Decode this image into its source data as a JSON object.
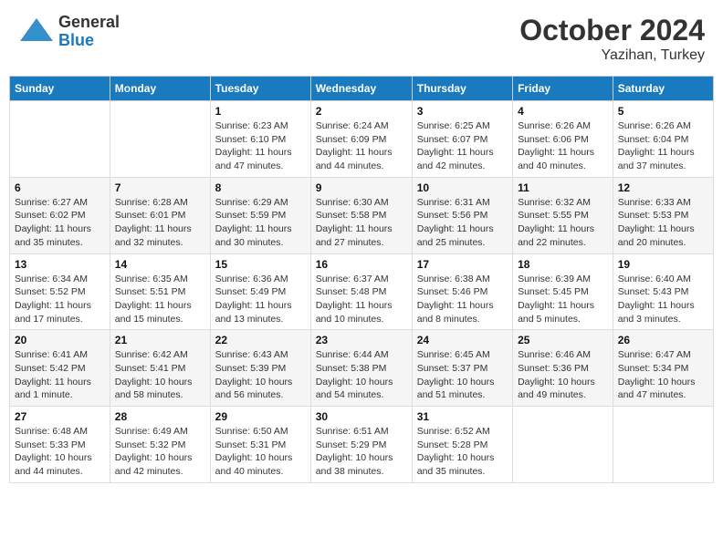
{
  "header": {
    "logo_general": "General",
    "logo_blue": "Blue",
    "month_title": "October 2024",
    "location": "Yazihan, Turkey"
  },
  "weekdays": [
    "Sunday",
    "Monday",
    "Tuesday",
    "Wednesday",
    "Thursday",
    "Friday",
    "Saturday"
  ],
  "weeks": [
    [
      {
        "day": "",
        "info": ""
      },
      {
        "day": "",
        "info": ""
      },
      {
        "day": "1",
        "info": "Sunrise: 6:23 AM\nSunset: 6:10 PM\nDaylight: 11 hours and 47 minutes."
      },
      {
        "day": "2",
        "info": "Sunrise: 6:24 AM\nSunset: 6:09 PM\nDaylight: 11 hours and 44 minutes."
      },
      {
        "day": "3",
        "info": "Sunrise: 6:25 AM\nSunset: 6:07 PM\nDaylight: 11 hours and 42 minutes."
      },
      {
        "day": "4",
        "info": "Sunrise: 6:26 AM\nSunset: 6:06 PM\nDaylight: 11 hours and 40 minutes."
      },
      {
        "day": "5",
        "info": "Sunrise: 6:26 AM\nSunset: 6:04 PM\nDaylight: 11 hours and 37 minutes."
      }
    ],
    [
      {
        "day": "6",
        "info": "Sunrise: 6:27 AM\nSunset: 6:02 PM\nDaylight: 11 hours and 35 minutes."
      },
      {
        "day": "7",
        "info": "Sunrise: 6:28 AM\nSunset: 6:01 PM\nDaylight: 11 hours and 32 minutes."
      },
      {
        "day": "8",
        "info": "Sunrise: 6:29 AM\nSunset: 5:59 PM\nDaylight: 11 hours and 30 minutes."
      },
      {
        "day": "9",
        "info": "Sunrise: 6:30 AM\nSunset: 5:58 PM\nDaylight: 11 hours and 27 minutes."
      },
      {
        "day": "10",
        "info": "Sunrise: 6:31 AM\nSunset: 5:56 PM\nDaylight: 11 hours and 25 minutes."
      },
      {
        "day": "11",
        "info": "Sunrise: 6:32 AM\nSunset: 5:55 PM\nDaylight: 11 hours and 22 minutes."
      },
      {
        "day": "12",
        "info": "Sunrise: 6:33 AM\nSunset: 5:53 PM\nDaylight: 11 hours and 20 minutes."
      }
    ],
    [
      {
        "day": "13",
        "info": "Sunrise: 6:34 AM\nSunset: 5:52 PM\nDaylight: 11 hours and 17 minutes."
      },
      {
        "day": "14",
        "info": "Sunrise: 6:35 AM\nSunset: 5:51 PM\nDaylight: 11 hours and 15 minutes."
      },
      {
        "day": "15",
        "info": "Sunrise: 6:36 AM\nSunset: 5:49 PM\nDaylight: 11 hours and 13 minutes."
      },
      {
        "day": "16",
        "info": "Sunrise: 6:37 AM\nSunset: 5:48 PM\nDaylight: 11 hours and 10 minutes."
      },
      {
        "day": "17",
        "info": "Sunrise: 6:38 AM\nSunset: 5:46 PM\nDaylight: 11 hours and 8 minutes."
      },
      {
        "day": "18",
        "info": "Sunrise: 6:39 AM\nSunset: 5:45 PM\nDaylight: 11 hours and 5 minutes."
      },
      {
        "day": "19",
        "info": "Sunrise: 6:40 AM\nSunset: 5:43 PM\nDaylight: 11 hours and 3 minutes."
      }
    ],
    [
      {
        "day": "20",
        "info": "Sunrise: 6:41 AM\nSunset: 5:42 PM\nDaylight: 11 hours and 1 minute."
      },
      {
        "day": "21",
        "info": "Sunrise: 6:42 AM\nSunset: 5:41 PM\nDaylight: 10 hours and 58 minutes."
      },
      {
        "day": "22",
        "info": "Sunrise: 6:43 AM\nSunset: 5:39 PM\nDaylight: 10 hours and 56 minutes."
      },
      {
        "day": "23",
        "info": "Sunrise: 6:44 AM\nSunset: 5:38 PM\nDaylight: 10 hours and 54 minutes."
      },
      {
        "day": "24",
        "info": "Sunrise: 6:45 AM\nSunset: 5:37 PM\nDaylight: 10 hours and 51 minutes."
      },
      {
        "day": "25",
        "info": "Sunrise: 6:46 AM\nSunset: 5:36 PM\nDaylight: 10 hours and 49 minutes."
      },
      {
        "day": "26",
        "info": "Sunrise: 6:47 AM\nSunset: 5:34 PM\nDaylight: 10 hours and 47 minutes."
      }
    ],
    [
      {
        "day": "27",
        "info": "Sunrise: 6:48 AM\nSunset: 5:33 PM\nDaylight: 10 hours and 44 minutes."
      },
      {
        "day": "28",
        "info": "Sunrise: 6:49 AM\nSunset: 5:32 PM\nDaylight: 10 hours and 42 minutes."
      },
      {
        "day": "29",
        "info": "Sunrise: 6:50 AM\nSunset: 5:31 PM\nDaylight: 10 hours and 40 minutes."
      },
      {
        "day": "30",
        "info": "Sunrise: 6:51 AM\nSunset: 5:29 PM\nDaylight: 10 hours and 38 minutes."
      },
      {
        "day": "31",
        "info": "Sunrise: 6:52 AM\nSunset: 5:28 PM\nDaylight: 10 hours and 35 minutes."
      },
      {
        "day": "",
        "info": ""
      },
      {
        "day": "",
        "info": ""
      }
    ]
  ]
}
